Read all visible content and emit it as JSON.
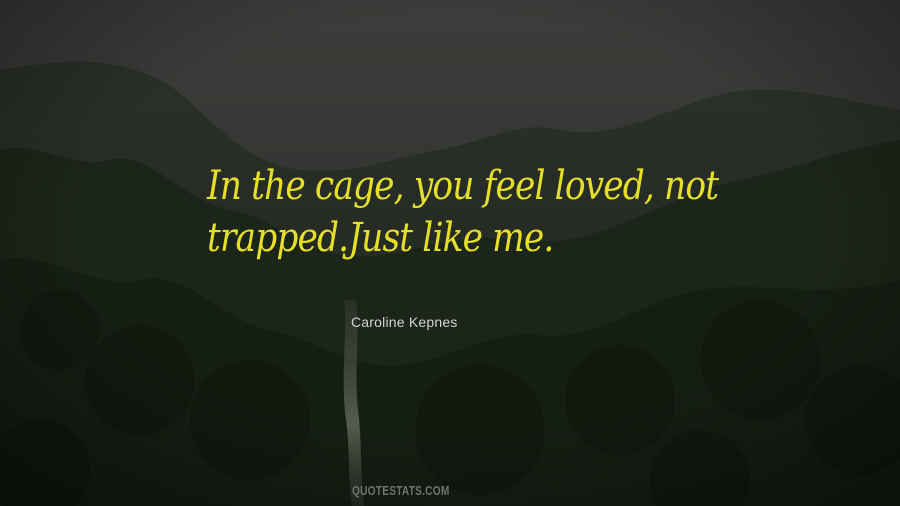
{
  "quote": {
    "lines": [
      "In the cage, you feel loved, not",
      "trapped.Just like me."
    ]
  },
  "author": "Caroline Kepnes",
  "watermark": "QUOTESTATS.COM",
  "colors": {
    "quote_text": "#e6df2a",
    "author_text": "#d2d6d0",
    "watermark_text": "#6f756f",
    "sky": "#3a3c3a",
    "forest": "#1a2418"
  }
}
